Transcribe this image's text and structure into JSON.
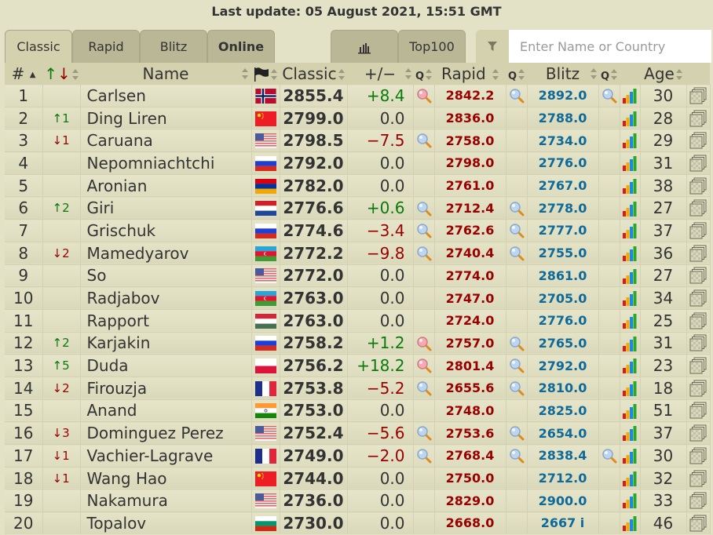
{
  "header": {
    "last_update": "Last update: 05 August 2021, 15:51 GMT"
  },
  "tabs": [
    {
      "label": "Classic",
      "active": true
    },
    {
      "label": "Rapid"
    },
    {
      "label": "Blitz"
    },
    {
      "label": "Online",
      "bold": true
    }
  ],
  "tabs_right": {
    "chart_icon": "bar-chart-icon",
    "top100_label": "Top100"
  },
  "search": {
    "placeholder": "Enter Name or Country",
    "value": "",
    "filter_icon": "filter-icon"
  },
  "columns": {
    "rank": "#",
    "change_icon": "up-down-arrows-icon",
    "name": "Name",
    "flag_icon": "flag-icon",
    "classic": "Classic",
    "diff": "+/−",
    "rapid": "Rapid",
    "blitz": "Blitz",
    "age": "Age"
  },
  "colors": {
    "up": "#0a7a0a",
    "down": "#9a0000",
    "rapid": "#9a0000",
    "blitz": "#0f6a9a",
    "header_bg": "#d4d2ae",
    "page_bg": "#e3e2c6"
  },
  "rows": [
    {
      "rank": "1",
      "change": "",
      "dir": "",
      "name": "Carlsen",
      "country": "NOR",
      "classic": "2855.4",
      "diff": "+8.4",
      "diff_sign": "pos",
      "classic_mag": "red",
      "rapid": "2842.2",
      "rapid_mag": "blue",
      "blitz": "2892.0",
      "blitz_mag": "blue",
      "age": "30"
    },
    {
      "rank": "2",
      "change": "↑1",
      "dir": "up",
      "name": "Ding Liren",
      "country": "CHN",
      "classic": "2799.0",
      "diff": "0.0",
      "diff_sign": "zero",
      "classic_mag": "",
      "rapid": "2836.0",
      "rapid_mag": "",
      "blitz": "2788.0",
      "blitz_mag": "",
      "age": "28"
    },
    {
      "rank": "3",
      "change": "↓1",
      "dir": "down",
      "name": "Caruana",
      "country": "USA",
      "classic": "2798.5",
      "diff": "−7.5",
      "diff_sign": "neg",
      "classic_mag": "blue",
      "rapid": "2758.0",
      "rapid_mag": "",
      "blitz": "2734.0",
      "blitz_mag": "",
      "age": "29"
    },
    {
      "rank": "4",
      "change": "",
      "dir": "",
      "name": "Nepomniachtchi",
      "country": "RUS",
      "classic": "2792.0",
      "diff": "0.0",
      "diff_sign": "zero",
      "classic_mag": "",
      "rapid": "2798.0",
      "rapid_mag": "",
      "blitz": "2776.0",
      "blitz_mag": "",
      "age": "31"
    },
    {
      "rank": "5",
      "change": "",
      "dir": "",
      "name": "Aronian",
      "country": "ARM",
      "classic": "2782.0",
      "diff": "0.0",
      "diff_sign": "zero",
      "classic_mag": "",
      "rapid": "2761.0",
      "rapid_mag": "",
      "blitz": "2767.0",
      "blitz_mag": "",
      "age": "38"
    },
    {
      "rank": "6",
      "change": "↑2",
      "dir": "up",
      "name": "Giri",
      "country": "NED",
      "classic": "2776.6",
      "diff": "+0.6",
      "diff_sign": "pos",
      "classic_mag": "blue",
      "rapid": "2712.4",
      "rapid_mag": "blue",
      "blitz": "2778.0",
      "blitz_mag": "",
      "age": "27"
    },
    {
      "rank": "7",
      "change": "",
      "dir": "",
      "name": "Grischuk",
      "country": "RUS",
      "classic": "2774.6",
      "diff": "−3.4",
      "diff_sign": "neg",
      "classic_mag": "blue",
      "rapid": "2762.6",
      "rapid_mag": "blue",
      "blitz": "2777.0",
      "blitz_mag": "",
      "age": "37"
    },
    {
      "rank": "8",
      "change": "↓2",
      "dir": "down",
      "name": "Mamedyarov",
      "country": "AZE",
      "classic": "2772.2",
      "diff": "−9.8",
      "diff_sign": "neg",
      "classic_mag": "blue",
      "rapid": "2740.4",
      "rapid_mag": "blue",
      "blitz": "2755.0",
      "blitz_mag": "",
      "age": "36"
    },
    {
      "rank": "9",
      "change": "",
      "dir": "",
      "name": "So",
      "country": "USA",
      "classic": "2772.0",
      "diff": "0.0",
      "diff_sign": "zero",
      "classic_mag": "",
      "rapid": "2774.0",
      "rapid_mag": "",
      "blitz": "2861.0",
      "blitz_mag": "",
      "age": "27"
    },
    {
      "rank": "10",
      "change": "",
      "dir": "",
      "name": "Radjabov",
      "country": "AZE",
      "classic": "2763.0",
      "diff": "0.0",
      "diff_sign": "zero",
      "classic_mag": "",
      "rapid": "2747.0",
      "rapid_mag": "",
      "blitz": "2705.0",
      "blitz_mag": "",
      "age": "34"
    },
    {
      "rank": "11",
      "change": "",
      "dir": "",
      "name": "Rapport",
      "country": "HUN",
      "classic": "2763.0",
      "diff": "0.0",
      "diff_sign": "zero",
      "classic_mag": "",
      "rapid": "2724.0",
      "rapid_mag": "",
      "blitz": "2776.0",
      "blitz_mag": "",
      "age": "25"
    },
    {
      "rank": "12",
      "change": "↑2",
      "dir": "up",
      "name": "Karjakin",
      "country": "RUS",
      "classic": "2758.2",
      "diff": "+1.2",
      "diff_sign": "pos",
      "classic_mag": "red",
      "rapid": "2757.0",
      "rapid_mag": "blue",
      "blitz": "2765.0",
      "blitz_mag": "",
      "age": "31"
    },
    {
      "rank": "13",
      "change": "↑5",
      "dir": "up",
      "name": "Duda",
      "country": "POL",
      "classic": "2756.2",
      "diff": "+18.2",
      "diff_sign": "pos",
      "classic_mag": "red",
      "rapid": "2801.4",
      "rapid_mag": "blue",
      "blitz": "2792.0",
      "blitz_mag": "",
      "age": "23"
    },
    {
      "rank": "14",
      "change": "↓2",
      "dir": "down",
      "name": "Firouzja",
      "country": "FRA",
      "classic": "2753.8",
      "diff": "−5.2",
      "diff_sign": "neg",
      "classic_mag": "blue",
      "rapid": "2655.6",
      "rapid_mag": "blue",
      "blitz": "2810.0",
      "blitz_mag": "",
      "age": "18"
    },
    {
      "rank": "15",
      "change": "",
      "dir": "",
      "name": "Anand",
      "country": "IND",
      "classic": "2753.0",
      "diff": "0.0",
      "diff_sign": "zero",
      "classic_mag": "",
      "rapid": "2748.0",
      "rapid_mag": "",
      "blitz": "2825.0",
      "blitz_mag": "",
      "age": "51"
    },
    {
      "rank": "16",
      "change": "↓3",
      "dir": "down",
      "name": "Dominguez Perez",
      "country": "USA",
      "classic": "2752.4",
      "diff": "−5.6",
      "diff_sign": "neg",
      "classic_mag": "blue",
      "rapid": "2753.6",
      "rapid_mag": "blue",
      "blitz": "2654.0",
      "blitz_mag": "",
      "age": "37"
    },
    {
      "rank": "17",
      "change": "↓1",
      "dir": "down",
      "name": "Vachier-Lagrave",
      "country": "FRA",
      "classic": "2749.0",
      "diff": "−2.0",
      "diff_sign": "neg",
      "classic_mag": "blue",
      "rapid": "2768.4",
      "rapid_mag": "blue",
      "blitz": "2838.4",
      "blitz_mag": "blue",
      "age": "30"
    },
    {
      "rank": "18",
      "change": "↓1",
      "dir": "down",
      "name": "Wang Hao",
      "country": "CHN",
      "classic": "2744.0",
      "diff": "0.0",
      "diff_sign": "zero",
      "classic_mag": "",
      "rapid": "2750.0",
      "rapid_mag": "",
      "blitz": "2712.0",
      "blitz_mag": "",
      "age": "32"
    },
    {
      "rank": "19",
      "change": "",
      "dir": "",
      "name": "Nakamura",
      "country": "USA",
      "classic": "2736.0",
      "diff": "0.0",
      "diff_sign": "zero",
      "classic_mag": "",
      "rapid": "2829.0",
      "rapid_mag": "",
      "blitz": "2900.0",
      "blitz_mag": "",
      "age": "33"
    },
    {
      "rank": "20",
      "change": "",
      "dir": "",
      "name": "Topalov",
      "country": "BUL",
      "classic": "2730.0",
      "diff": "0.0",
      "diff_sign": "zero",
      "classic_mag": "",
      "rapid": "2668.0",
      "rapid_mag": "",
      "blitz": "2667 i",
      "blitz_mag": "",
      "age": "46"
    }
  ]
}
